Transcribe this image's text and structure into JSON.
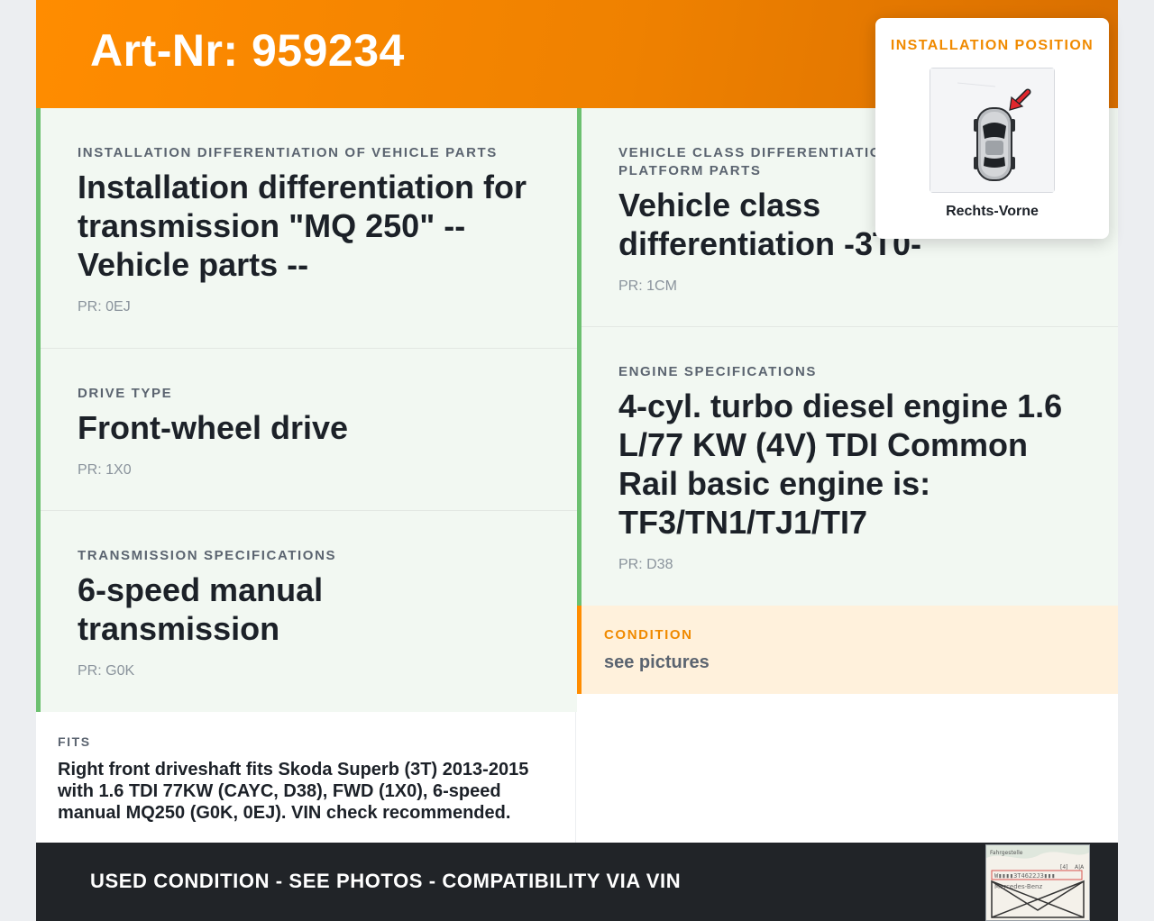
{
  "header": {
    "title": "Art-Nr: 959234"
  },
  "cards_left": [
    {
      "label": "INSTALLATION DIFFERENTIATION OF VEHICLE PARTS",
      "value": "Installation differentiation for transmission \"MQ 250\" -- Vehicle parts --",
      "pr": "PR: 0EJ"
    },
    {
      "label": "DRIVE TYPE",
      "value": "Front-wheel drive",
      "pr": "PR: 1X0"
    },
    {
      "label": "TRANSMISSION SPECIFICATIONS",
      "value": "6-speed manual transmission",
      "pr": "PR: G0K"
    }
  ],
  "cards_right": [
    {
      "label": "VEHICLE CLASS DIFFERENTIATION PLATFORM PARTS",
      "value": "Vehicle class differentiation -3T0-",
      "pr": "PR: 1CM"
    },
    {
      "label": "ENGINE SPECIFICATIONS",
      "value": "4-cyl. turbo diesel engine 1.6 L/77 KW (4V) TDI Common Rail basic engine is: TF3/TN1/TJ1/TI7",
      "pr": "PR: D38"
    }
  ],
  "condition": {
    "label": "CONDITION",
    "value": "see pictures"
  },
  "fits": {
    "label": "FITS",
    "value": "Right front driveshaft fits Skoda Superb (3T) 2013-2015 with 1.6 TDI 77KW (CAYC, D38), FWD (1X0), 6-speed manual MQ250 (G0K, 0EJ). VIN check recommended."
  },
  "footer": {
    "text": "USED CONDITION - SEE PHOTOS - COMPATIBILITY VIA VIN",
    "thumb_lines": [
      "Fahrgestelle",
      "[4]",
      "A|A",
      "W▮▮▮▮3T4622J3▮▮▮",
      "Mercedes-Benz"
    ]
  },
  "installation": {
    "label": "INSTALLATION POSITION",
    "position": "Rechts-Vorne",
    "icon": "car-top-view-with-arrow"
  },
  "colors": {
    "accent": "#ff8c00",
    "card_bg": "#f2f8f2",
    "card_border": "#6cc070",
    "condition_bg": "#fff1dc",
    "footer_bg": "#212428"
  }
}
